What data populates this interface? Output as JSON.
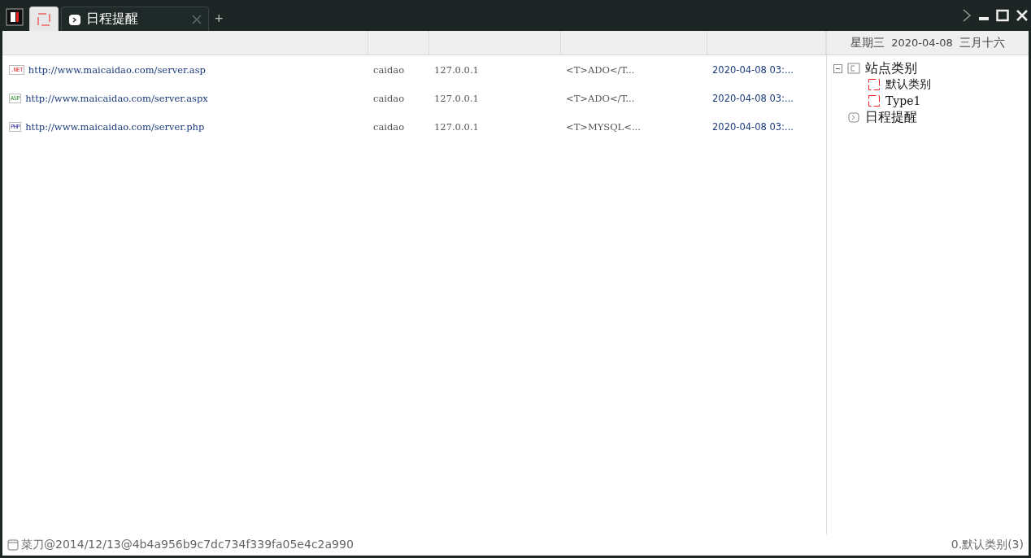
{
  "tabs": [
    {
      "kind": "sites",
      "selected": true
    },
    {
      "kind": "schedule",
      "label": "日程提醒",
      "selected": false
    }
  ],
  "add_tab": "+",
  "date_header": {
    "weekday": "星期三",
    "date": "2020-04-08",
    "lunar": "三月十六"
  },
  "rows": [
    {
      "kind": "net",
      "badge": ".NET",
      "url": "http://www.maicaidao.com/server.asp",
      "user": "caidao",
      "ip": "127.0.0.1",
      "config": "<T>ADO</T...",
      "time": "2020-04-08 03:..."
    },
    {
      "kind": "asp",
      "badge": "ASP",
      "url": "http://www.maicaidao.com/server.aspx",
      "user": "caidao",
      "ip": "127.0.0.1",
      "config": "<T>ADO</T...",
      "time": "2020-04-08 03:..."
    },
    {
      "kind": "php",
      "badge": "PHP",
      "url": "http://www.maicaidao.com/server.php",
      "user": "caidao",
      "ip": "127.0.0.1",
      "config": "<T>MYSQL<...",
      "time": "2020-04-08 03:..."
    }
  ],
  "tree": [
    {
      "kind": "folder",
      "label": "站点类别",
      "expanded": true,
      "children": [
        {
          "kind": "category",
          "label": "默认类别"
        },
        {
          "kind": "category",
          "label": "Type1"
        }
      ]
    },
    {
      "kind": "schedule",
      "label": "日程提醒"
    }
  ],
  "status_bar": {
    "left": "菜刀@2014/12/13@4b4a956b9c7dc734f339fa05e4c2a990",
    "right": "0.默认类别(3)"
  }
}
